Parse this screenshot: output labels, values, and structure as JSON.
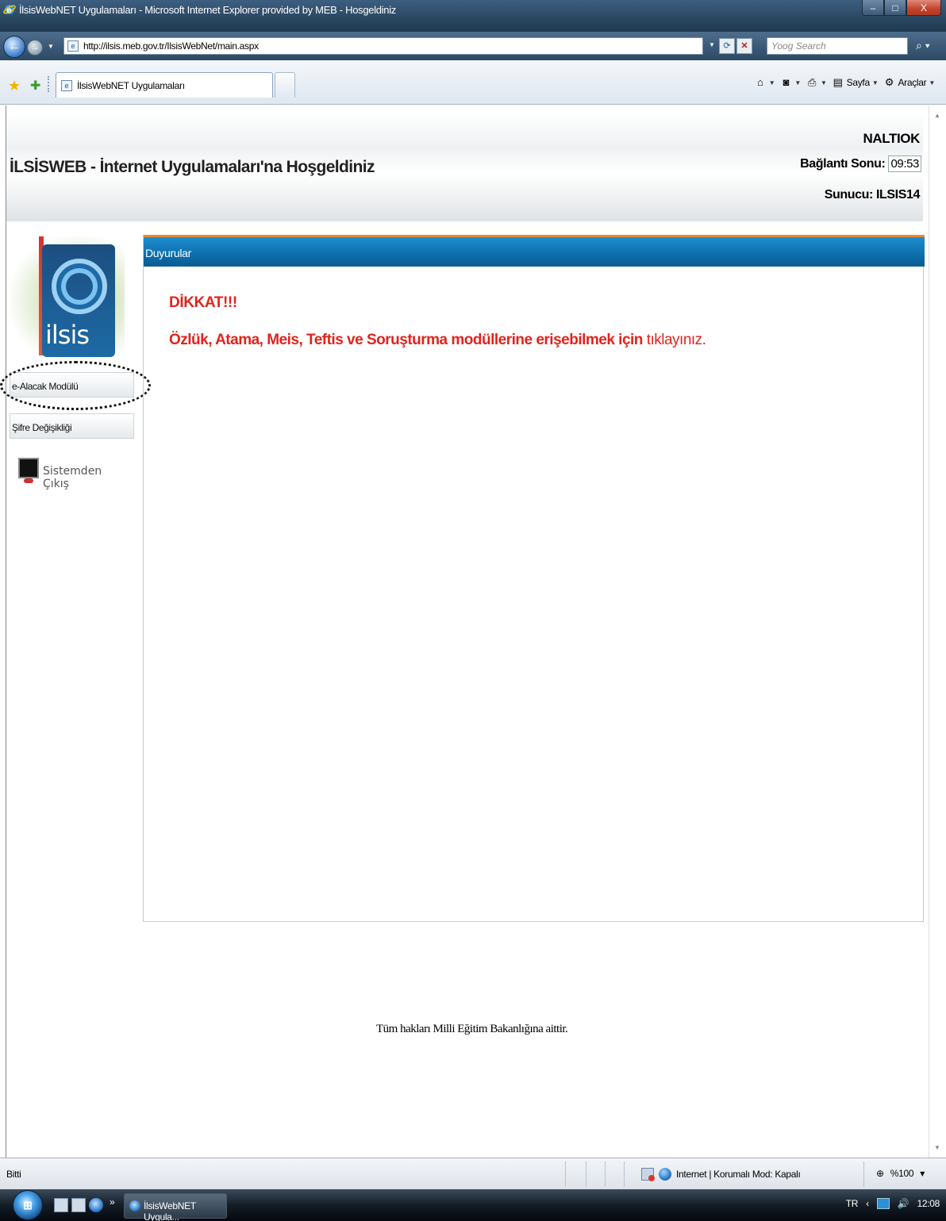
{
  "window": {
    "title": "İlsisWebNET Uygulamaları - Microsoft Internet Explorer provided by MEB - Hosgeldiniz",
    "minimize": "–",
    "maximize": "□",
    "close": "X"
  },
  "address_bar": {
    "url": "http://ilsis.meb.gov.tr/IlsisWebNet/main.aspx",
    "search_placeholder": "Yoog Search"
  },
  "tabs": [
    {
      "label": "İlsisWebNET Uygulamaları"
    }
  ],
  "command_bar": {
    "page_label": "Sayfa",
    "tools_label": "Araçlar"
  },
  "header": {
    "title": "İLSİSWEB - İnternet Uygulamaları'na Hoşgeldiniz",
    "username": "NALTIOK",
    "connection_label": "Bağlantı Sonu:",
    "connection_time": "09:53",
    "server_label": "Sunucu: ILSIS14"
  },
  "sidebar": {
    "logo_text": "ilsis",
    "items": [
      {
        "label": "e-Alacak Modülü"
      },
      {
        "label": "Şifre Değişikliği"
      }
    ],
    "logout_label": "Sistemden Çıkış"
  },
  "announcements": {
    "title": "Duyurular",
    "warning": "DİKKAT!!!",
    "message": "Özlük, Atama, Meis, Teftis ve Soruşturma modüllerine erişebilmek için ",
    "link_text": "tıklayınız."
  },
  "footer": {
    "copyright": "Tüm hakları Milli Eğitim Bakanlığına aittir."
  },
  "status_bar": {
    "status": "Bitti",
    "zone": "Internet | Korumalı Mod: Kapalı",
    "zoom": "%100"
  },
  "taskbar": {
    "task_label": "İlsisWebNET Uygula...",
    "language": "TR",
    "clock": "12:08"
  },
  "colors": {
    "warning_red": "#e0241b",
    "panel_header_blue": "#0d6eab",
    "panel_header_accent": "#e88b2e"
  }
}
